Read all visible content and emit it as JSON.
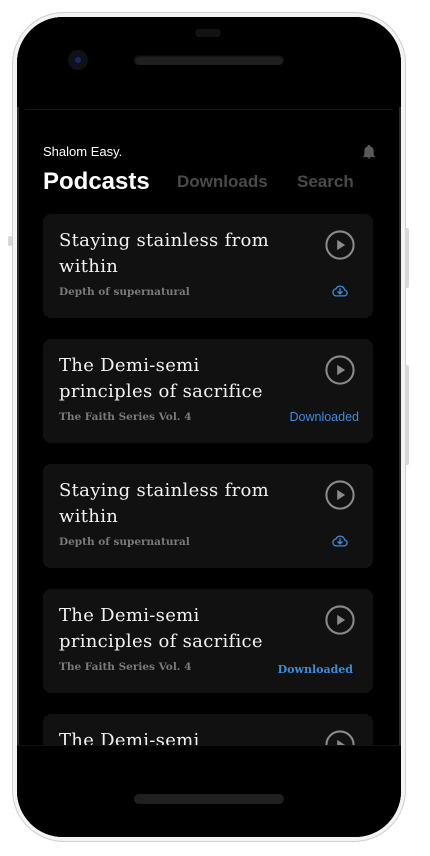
{
  "app": {
    "greeting": "Shalom Easy.",
    "tabs": [
      {
        "label": "Podcasts",
        "active": true
      },
      {
        "label": "Downloads",
        "active": false
      },
      {
        "label": "Search",
        "active": false
      }
    ],
    "colors": {
      "accent": "#3d8bdb",
      "card_bg": "#111111",
      "background": "#000000"
    }
  },
  "podcasts": [
    {
      "title": "Staying stainless from within",
      "series": "Depth of supernatural",
      "status": "download",
      "status_text": ""
    },
    {
      "title": "The Demi-semi principles of sacrifice",
      "series": "The Faith Series Vol. 4",
      "status": "downloaded",
      "status_text": "Downloaded"
    },
    {
      "title": "Staying stainless from within",
      "series": "Depth of supernatural",
      "status": "download",
      "status_text": ""
    },
    {
      "title": "The Demi-semi principles of sacrifice",
      "series": "The Faith Series Vol. 4",
      "status": "downloaded",
      "status_text": "Downloaded"
    },
    {
      "title": "The Demi-semi principles of sacrifice",
      "series": "",
      "status": "none",
      "status_text": ""
    }
  ],
  "icons": {
    "bell": "bell-icon",
    "play": "play-circle-icon",
    "download": "cloud-download-icon"
  }
}
